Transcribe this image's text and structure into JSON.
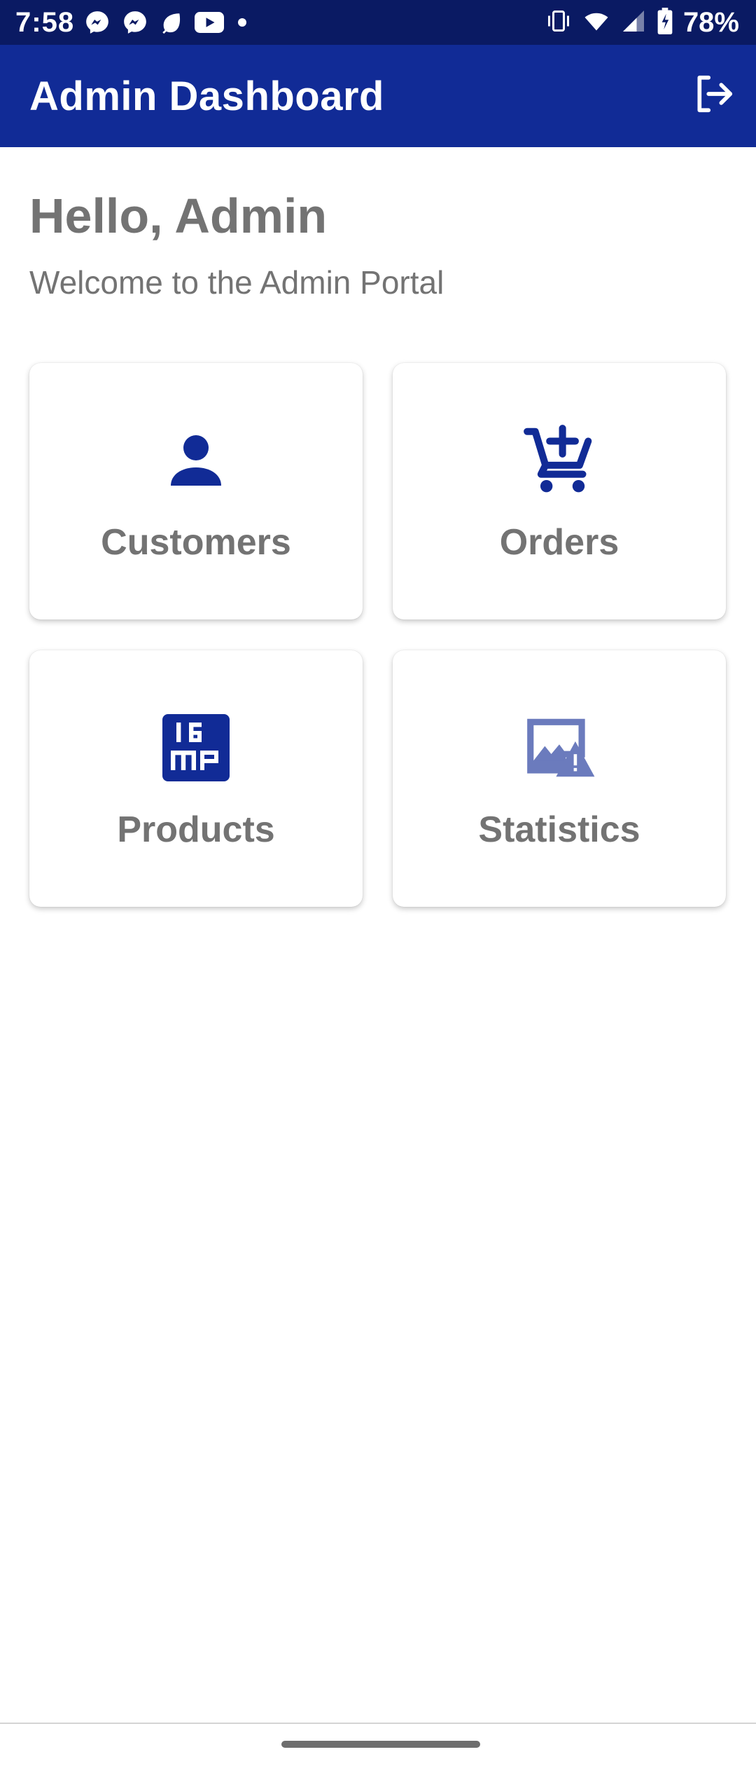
{
  "status_bar": {
    "time": "7:58",
    "battery": "78%",
    "left_icons": [
      "messenger-icon",
      "messenger-icon",
      "leaf-icon",
      "youtube-icon",
      "dot-icon"
    ],
    "right_icons": [
      "vibrate-icon",
      "wifi-icon",
      "signal-icon",
      "battery-charging-icon"
    ]
  },
  "app_bar": {
    "title": "Admin Dashboard",
    "logout_icon": "logout-icon"
  },
  "greeting": {
    "title": "Hello, Admin",
    "subtitle": "Welcome to the Admin Portal"
  },
  "tiles": [
    {
      "label": "Customers",
      "icon": "person-icon"
    },
    {
      "label": "Orders",
      "icon": "add-shopping-cart-icon"
    },
    {
      "label": "Products",
      "icon": "16mp-icon"
    },
    {
      "label": "Statistics",
      "icon": "broken-image-icon"
    }
  ],
  "colors": {
    "status_bar_bg": "#0a1a63",
    "app_bar_bg": "#112b96",
    "icon_primary": "#112b96",
    "icon_faded": "#6a7cc4",
    "text_gray": "#737373"
  }
}
